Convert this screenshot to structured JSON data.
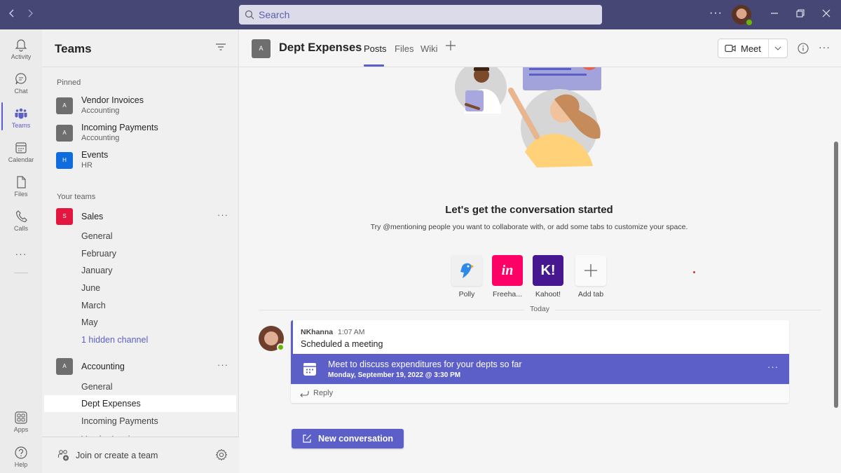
{
  "titlebar": {
    "back_icon": "chevron-left-icon",
    "forward_icon": "chevron-right-icon",
    "search_placeholder": "Search",
    "more_label": "···",
    "window_controls": [
      "minimize-icon",
      "restore-icon",
      "close-icon"
    ],
    "accent_color": "#464775"
  },
  "rail": {
    "items": [
      {
        "label": "Activity",
        "icon": "bell-icon"
      },
      {
        "label": "Chat",
        "icon": "chat-icon"
      },
      {
        "label": "Teams",
        "icon": "teams-icon",
        "active": true
      },
      {
        "label": "Calendar",
        "icon": "calendar-icon"
      },
      {
        "label": "Files",
        "icon": "file-icon"
      },
      {
        "label": "Calls",
        "icon": "phone-icon"
      }
    ],
    "more_label": "···",
    "bottom_items": [
      {
        "label": "Apps",
        "icon": "apps-icon"
      },
      {
        "label": "Help",
        "icon": "help-icon"
      }
    ]
  },
  "teams_panel": {
    "title": "Teams",
    "pinned_label": "Pinned",
    "pinned": [
      {
        "name": "Vendor Invoices",
        "team": "Accounting",
        "initial": "A",
        "color": "#6e6e6e"
      },
      {
        "name": "Incoming Payments",
        "team": "Accounting",
        "initial": "A",
        "color": "#6e6e6e"
      },
      {
        "name": "Events",
        "team": "HR",
        "initial": "H",
        "color": "#0f6cdd"
      }
    ],
    "your_teams_label": "Your teams",
    "teams": [
      {
        "name": "Sales",
        "initial": "S",
        "color": "#e3163f",
        "more": "···",
        "channels": [
          "General",
          "February",
          "January",
          "June",
          "March",
          "May"
        ],
        "hidden": "1 hidden channel"
      },
      {
        "name": "Accounting",
        "initial": "A",
        "color": "#6e6e6e",
        "more": "···",
        "channels": [
          "General",
          "Dept Expenses",
          "Incoming Payments",
          "Vendor Invoices"
        ],
        "active_channel": "Dept Expenses"
      }
    ],
    "join_label": "Join or create a team"
  },
  "channel": {
    "initial": "A",
    "title": "Dept Expenses",
    "tabs": [
      "Posts",
      "Files",
      "Wiki"
    ],
    "active_tab": "Posts",
    "meet_label": "Meet"
  },
  "empty_state": {
    "title": "Let's get the conversation started",
    "subtitle": "Try @mentioning people you want to collaborate with, or add some tabs to customize your space.",
    "apps": [
      {
        "label": "Polly",
        "color": "#f0f0f0"
      },
      {
        "label": "Freeha...",
        "glyph": "in",
        "color": "#ff0066"
      },
      {
        "label": "Kahoot!",
        "glyph": "K!",
        "color": "#46178f"
      },
      {
        "label": "Add tab",
        "glyph": "+",
        "color": "#fafafa"
      }
    ]
  },
  "feed": {
    "date_divider": "Today",
    "message": {
      "author": "NKhanna",
      "time": "1:07 AM",
      "text": "Scheduled a meeting",
      "meeting": {
        "title": "Meet to discuss expenditures for your depts so far",
        "datetime": "Monday, September 19, 2022 @ 3:30 PM",
        "more": "···"
      },
      "reply_label": "Reply"
    },
    "new_conversation_label": "New conversation"
  },
  "colors": {
    "brand": "#5b5fc7",
    "presence_available": "#6bb700"
  }
}
